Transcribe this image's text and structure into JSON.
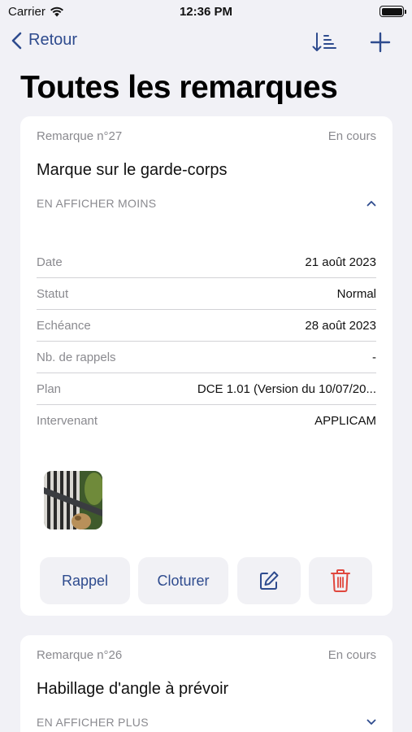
{
  "status_bar": {
    "carrier": "Carrier",
    "time": "12:36 PM",
    "battery_level": 1.0
  },
  "nav": {
    "back_label": "Retour",
    "icons": [
      "chevron-left-icon",
      "sort-icon",
      "plus-icon"
    ],
    "accent_color": "#2e4b8e"
  },
  "page": {
    "title": "Toutes les remarques"
  },
  "remarks": [
    {
      "number": "Remarque n°27",
      "status": "En cours",
      "title": "Marque sur le garde-corps",
      "toggle_label": "EN AFFICHER MOINS",
      "expanded": true,
      "details": [
        {
          "label": "Date",
          "value": "21 août 2023"
        },
        {
          "label": "Statut",
          "value": "Normal"
        },
        {
          "label": "Echéance",
          "value": "28 août 2023"
        },
        {
          "label": "Nb. de rappels",
          "value": "-"
        },
        {
          "label": "Plan",
          "value": "DCE 1.01 (Version du 10/07/20..."
        },
        {
          "label": "Intervenant",
          "value": "APPLICAM"
        }
      ],
      "actions": {
        "rappel": "Rappel",
        "cloturer": "Cloturer",
        "edit_icon": "edit-icon",
        "delete_icon": "trash-icon",
        "delete_color": "#e0473e"
      }
    },
    {
      "number": "Remarque n°26",
      "status": "En cours",
      "title": "Habillage d'angle à prévoir",
      "toggle_label": "EN AFFICHER PLUS",
      "expanded": false
    }
  ]
}
